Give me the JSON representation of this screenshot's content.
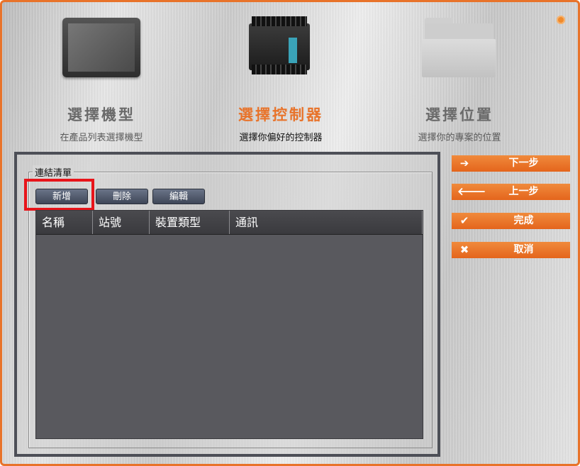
{
  "steps": [
    {
      "title": "選擇機型",
      "subtitle": "在產品列表選擇機型",
      "icon": "monitor-icon",
      "active": false
    },
    {
      "title": "選擇控制器",
      "subtitle": "選擇你偏好的控制器",
      "icon": "plc-controller-icon",
      "active": true
    },
    {
      "title": "選擇位置",
      "subtitle": "選擇你的專案的位置",
      "icon": "folder-icon",
      "active": false
    }
  ],
  "link_list": {
    "label": "連結清單",
    "buttons": {
      "add": "新增",
      "delete": "刪除",
      "edit": "編輯"
    },
    "columns": [
      "名稱",
      "站號",
      "裝置類型",
      "通訊"
    ],
    "rows": []
  },
  "nav": {
    "next": "下一步",
    "prev": "上一步",
    "finish": "完成",
    "cancel": "取消"
  },
  "colors": {
    "accent": "#e8732a",
    "highlight": "#e8141a",
    "panel_border": "#4d4f57",
    "table_bg": "#59595e"
  }
}
